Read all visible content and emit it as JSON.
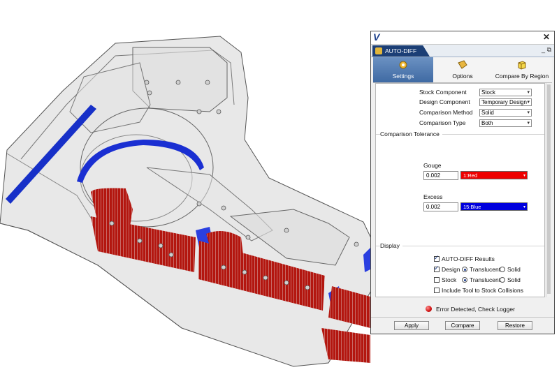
{
  "panel": {
    "logo": "V",
    "tab_title": "AUTO-DIFF",
    "ribbon": [
      {
        "label": "Settings",
        "icon": "gear-icon",
        "active": true
      },
      {
        "label": "Options",
        "icon": "options-icon",
        "active": false
      },
      {
        "label": "Compare By Region",
        "icon": "cube-icon",
        "active": false
      }
    ],
    "settings": {
      "stock_component": {
        "label": "Stock Component",
        "value": "Stock"
      },
      "design_component": {
        "label": "Design Component",
        "value": "Temporary Design"
      },
      "comparison_method": {
        "label": "Comparison Method",
        "value": "Solid"
      },
      "comparison_type": {
        "label": "Comparison Type",
        "value": "Both"
      }
    },
    "tolerance": {
      "header": "Comparison Tolerance",
      "gouge": {
        "label": "Gouge",
        "value": "0.002",
        "color_label": "1:Red",
        "color": "#ee0000"
      },
      "excess": {
        "label": "Excess",
        "value": "0.002",
        "color_label": "15:Blue",
        "color": "#0000dd"
      }
    },
    "display": {
      "header": "Display",
      "autodiff_results": {
        "label": "AUTO-DIFF Results",
        "checked": true
      },
      "design": {
        "label": "Design",
        "checked": true,
        "translucent": "Translucent",
        "solid": "Solid",
        "mode": "Translucent"
      },
      "stock": {
        "label": "Stock",
        "checked": false,
        "translucent": "Translucent",
        "solid": "Solid",
        "mode": "Translucent"
      },
      "include_tool": {
        "label": "Include Tool to Stock Collisions",
        "checked": false
      }
    },
    "status": "Error Detected, Check Logger",
    "buttons": {
      "apply": "Apply",
      "compare": "Compare",
      "restore": "Restore"
    }
  }
}
